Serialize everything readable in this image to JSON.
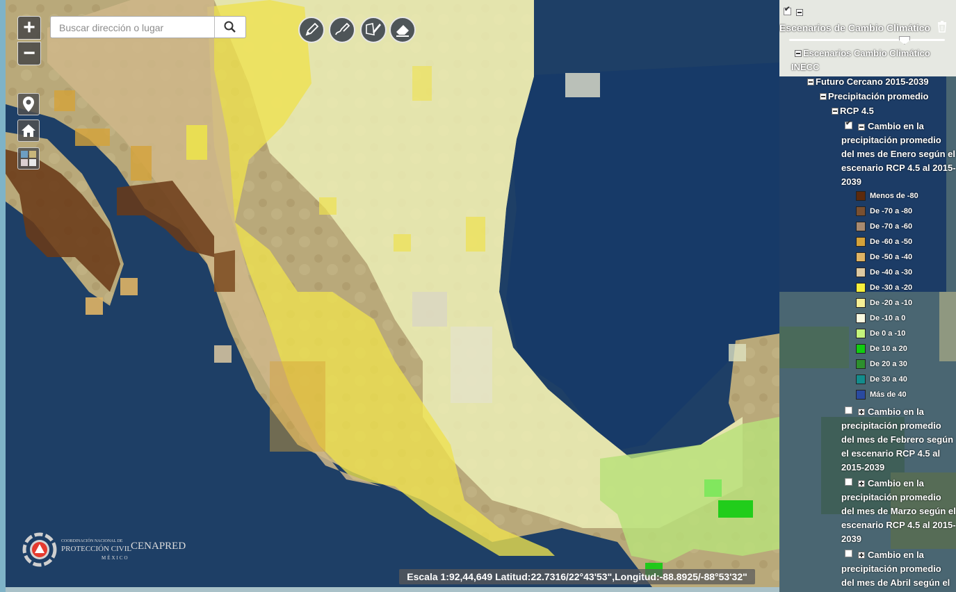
{
  "search": {
    "placeholder": "Buscar dirección o lugar"
  },
  "zoom": {
    "in_label": "+",
    "out_label": "−"
  },
  "scale_bar": "Escala 1:92,44,649 Latitud:22.7316/22°43'53\",Longitud:-88.8925/-88°53'32\"",
  "logo": {
    "line1": "COORDINACIÓN NACIONAL DE",
    "line2": "PROTECCIÓN CIVIL",
    "line3": "CENAPRED",
    "line4": "MÉXICO"
  },
  "panel": {
    "title": "Escenarios de Cambio Climático",
    "tree": {
      "root": "Escenarios Cambio Climático INECC",
      "period": "Futuro Cercano 2015-2039",
      "variable": "Precipitación promedio",
      "scenario": "RCP 4.5",
      "layers": [
        {
          "label": "Cambio en la precipitación promedio del mes de Enero según el escenario RCP 4.5 al 2015-2039",
          "checked": true,
          "expanded": true
        },
        {
          "label": "Cambio en la precipitación promedio del mes de Febrero según el escenario RCP 4.5 al 2015-2039",
          "checked": false,
          "expanded": false
        },
        {
          "label": "Cambio en la precipitación promedio del mes de Marzo según el escenario RCP 4.5 al 2015-2039",
          "checked": false,
          "expanded": false
        },
        {
          "label": "Cambio en la precipitación promedio del mes de Abril según el",
          "checked": false,
          "expanded": false
        }
      ]
    },
    "legend": [
      {
        "label": "Menos de -80",
        "color": "#5c2a0c"
      },
      {
        "label": "De -70 a -80",
        "color": "#7a5030"
      },
      {
        "label": "De -70 a -60",
        "color": "#a88a70"
      },
      {
        "label": "De -60 a -50",
        "color": "#d4a23a"
      },
      {
        "label": "De -50 a -40",
        "color": "#dfb465"
      },
      {
        "label": "De -40 a -30",
        "color": "#ddc9a2"
      },
      {
        "label": "De -30 a -20",
        "color": "#f5ef3d"
      },
      {
        "label": "De -20 a -10",
        "color": "#f6ef95"
      },
      {
        "label": "De -10 a 0",
        "color": "#fafae0"
      },
      {
        "label": "De 0 a -10",
        "color": "#c4f57c"
      },
      {
        "label": "De 10 a 20",
        "color": "#11cc11"
      },
      {
        "label": "De 20 a 30",
        "color": "#2d8f2d"
      },
      {
        "label": "De 30 a 40",
        "color": "#138c8c"
      },
      {
        "label": "Más de 40",
        "color": "#2a4aa0"
      }
    ]
  }
}
